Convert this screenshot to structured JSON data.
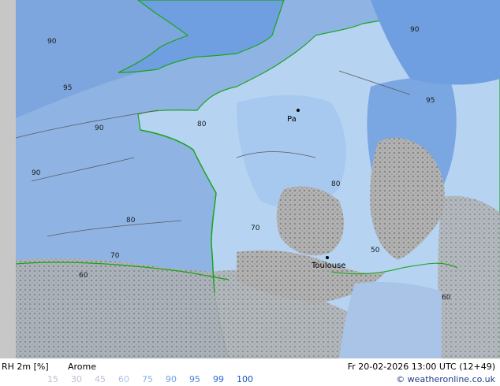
{
  "header": {
    "variable": "RH 2m [%]",
    "model": "Arome",
    "valid_time": "Fr 20-02-2026 13:00 UTC (12+49)",
    "credit": "© weatheronline.co.uk"
  },
  "legend": {
    "values": [
      "15",
      "30",
      "45",
      "60",
      "75",
      "90",
      "95",
      "99",
      "100"
    ],
    "colors": [
      "#e8ecf2",
      "#d6dde8",
      "#c3d0e2",
      "#a9c4e6",
      "#8fb4e4",
      "#6f9fe0",
      "#4f86d9",
      "#2f6bd0",
      "#1a52c0"
    ]
  },
  "map": {
    "cities": [
      {
        "name": "Paris",
        "label": "Pa"
      },
      {
        "name": "Toulouse",
        "label": "Toulouse"
      }
    ],
    "contour_labels": [
      "50",
      "60",
      "70",
      "80",
      "90",
      "95"
    ],
    "colors": {
      "sea": "#8fb4e4",
      "land_high": "#9bc0ec",
      "land_mid": "#b6d3f2",
      "land_low": "#c9d9ec",
      "terrain": "#a8a8a8",
      "coast": "#19a519",
      "contour": "#5a5a5a"
    }
  }
}
